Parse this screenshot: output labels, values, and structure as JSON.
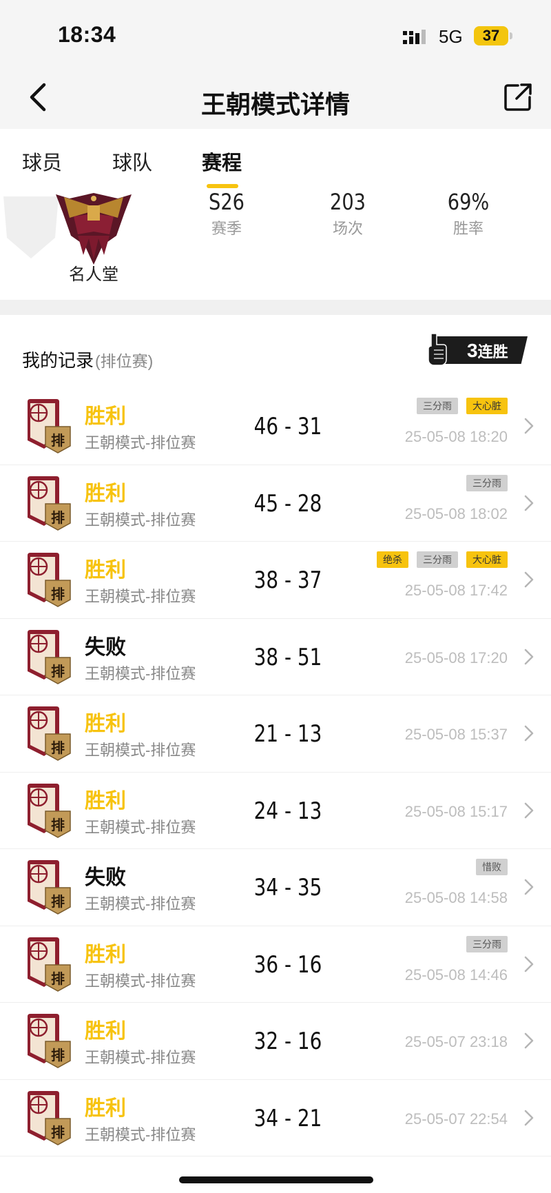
{
  "status_bar": {
    "time": "18:34",
    "network": "5G",
    "battery": "37"
  },
  "nav": {
    "title": "王朝模式详情"
  },
  "tabs": [
    {
      "label": "球员",
      "active": false
    },
    {
      "label": "球队",
      "active": false
    },
    {
      "label": "赛程",
      "active": true
    }
  ],
  "rank": {
    "name": "名人堂"
  },
  "stats": [
    {
      "value": "S26",
      "label": "赛季"
    },
    {
      "value": "203",
      "label": "场次"
    },
    {
      "value": "69%",
      "label": "胜率"
    }
  ],
  "records": {
    "title": "我的记录",
    "subtitle": "(排位赛)",
    "streak_count": "3",
    "streak_label": "连胜",
    "icon_badge": "排"
  },
  "matches": [
    {
      "result": "胜利",
      "outcome": "win",
      "mode": "王朝模式-排位赛",
      "score": "46 - 31",
      "datetime": "25-05-08 18:20",
      "tags": [
        {
          "text": "三分雨",
          "style": "grey"
        },
        {
          "text": "大心脏",
          "style": "yellow"
        }
      ]
    },
    {
      "result": "胜利",
      "outcome": "win",
      "mode": "王朝模式-排位赛",
      "score": "45 - 28",
      "datetime": "25-05-08 18:02",
      "tags": [
        {
          "text": "三分雨",
          "style": "grey"
        }
      ]
    },
    {
      "result": "胜利",
      "outcome": "win",
      "mode": "王朝模式-排位赛",
      "score": "38 - 37",
      "datetime": "25-05-08 17:42",
      "tags": [
        {
          "text": "绝杀",
          "style": "yellow"
        },
        {
          "text": "三分雨",
          "style": "grey"
        },
        {
          "text": "大心脏",
          "style": "yellow"
        }
      ]
    },
    {
      "result": "失败",
      "outcome": "loss",
      "mode": "王朝模式-排位赛",
      "score": "38 - 51",
      "datetime": "25-05-08 17:20",
      "tags": []
    },
    {
      "result": "胜利",
      "outcome": "win",
      "mode": "王朝模式-排位赛",
      "score": "21 - 13",
      "datetime": "25-05-08 15:37",
      "tags": []
    },
    {
      "result": "胜利",
      "outcome": "win",
      "mode": "王朝模式-排位赛",
      "score": "24 - 13",
      "datetime": "25-05-08 15:17",
      "tags": []
    },
    {
      "result": "失败",
      "outcome": "loss",
      "mode": "王朝模式-排位赛",
      "score": "34 - 35",
      "datetime": "25-05-08 14:58",
      "tags": [
        {
          "text": "惜败",
          "style": "grey"
        }
      ]
    },
    {
      "result": "胜利",
      "outcome": "win",
      "mode": "王朝模式-排位赛",
      "score": "36 - 16",
      "datetime": "25-05-08 14:46",
      "tags": [
        {
          "text": "三分雨",
          "style": "grey"
        }
      ]
    },
    {
      "result": "胜利",
      "outcome": "win",
      "mode": "王朝模式-排位赛",
      "score": "32 - 16",
      "datetime": "25-05-07 23:18",
      "tags": []
    },
    {
      "result": "胜利",
      "outcome": "win",
      "mode": "王朝模式-排位赛",
      "score": "34 - 21",
      "datetime": "25-05-07 22:54",
      "tags": []
    }
  ],
  "colors": {
    "accent": "#f7c30f",
    "tag_grey": "#d0d0d0",
    "dark": "#1c1c1c"
  }
}
